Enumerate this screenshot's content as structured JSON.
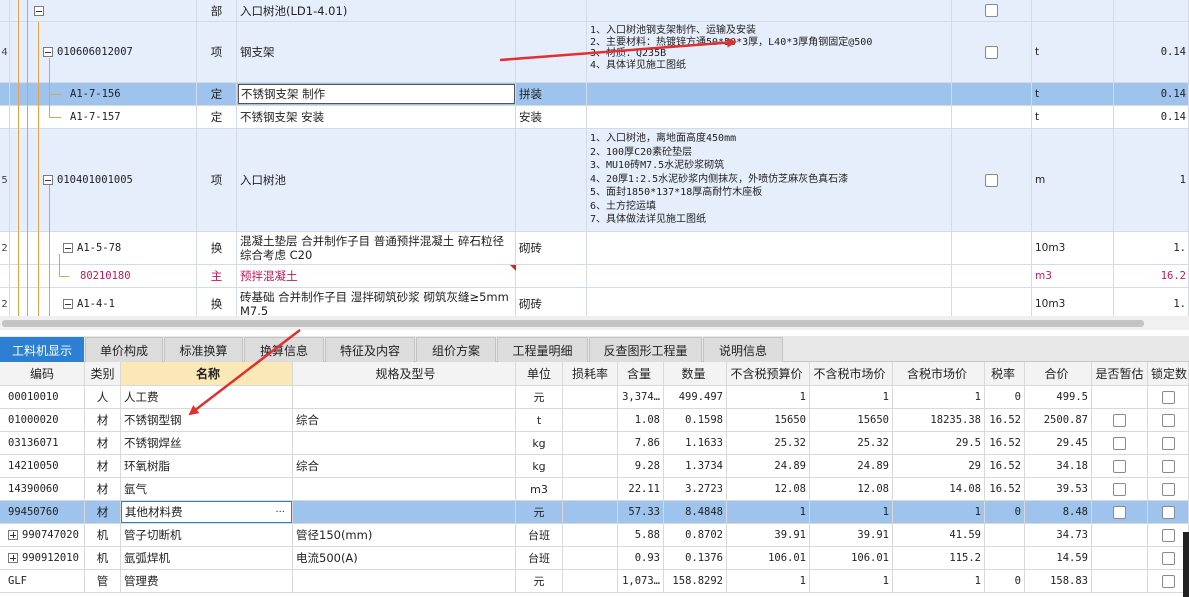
{
  "top_rows": [
    {
      "no": "",
      "code": "",
      "type": "部",
      "name": "入口树池(LD1-4.01)",
      "spec": "",
      "features": [],
      "unit": "",
      "qty": "",
      "has_checkbox": true
    },
    {
      "no": "4",
      "code": "010606012007",
      "type": "项",
      "name": "钢支架",
      "spec": "",
      "features": [
        "1、入口树池钢支架制作、运输及安装",
        "2、主要材料：热镀锌方通50*50*3厚，L40*3厚角钢固定@500",
        "3、材质：Q235B",
        "4、具体详见施工图纸"
      ],
      "unit": "t",
      "qty": "0.14",
      "has_checkbox": true
    },
    {
      "no": "",
      "code": "A1-7-156",
      "type": "定",
      "name": "不锈钢支架 制作",
      "spec": "拼装",
      "features": [],
      "unit": "t",
      "qty": "0.14",
      "has_checkbox": false
    },
    {
      "no": "",
      "code": "A1-7-157",
      "type": "定",
      "name": "不锈钢支架 安装",
      "spec": "安装",
      "features": [],
      "unit": "t",
      "qty": "0.14",
      "has_checkbox": false
    },
    {
      "no": "5",
      "code": "010401001005",
      "type": "项",
      "name": "入口树池",
      "spec": "",
      "features": [
        "1、入口树池，离地面高度450mm",
        "2、100厚C20素砼垫层",
        "3、MU10砖M7.5水泥砂浆砌筑",
        "4、20厚1:2.5水泥砂浆内侧抹灰，外喷仿芝麻灰色真石漆",
        "5、面封1850*137*18厚高耐竹木座板",
        "6、土方挖运填",
        "7、具体做法详见施工图纸"
      ],
      "unit": "m",
      "qty": "1",
      "has_checkbox": true
    },
    {
      "no": "2",
      "code": "A1-5-78",
      "type": "换",
      "name": "混凝土垫层  合并制作子目 普通预拌混凝土 碎石粒径综合考虑 C20",
      "spec": "砌砖",
      "features": [],
      "unit": "10m3",
      "qty": "1.",
      "has_checkbox": false
    },
    {
      "no": "",
      "code": "80210180",
      "type": "主",
      "name": "预拌混凝土",
      "spec": "",
      "features": [],
      "unit": "m3",
      "qty": "16.2",
      "has_checkbox": false
    },
    {
      "no": "2",
      "code": "A1-4-1",
      "type": "换",
      "name": "砖基础  合并制作子目 湿拌砌筑砂浆 砌筑灰缝≥5mm M7.5",
      "spec": "砌砖",
      "features": [],
      "unit": "10m3",
      "qty": "1.",
      "has_checkbox": false
    }
  ],
  "tabs": [
    "工料机显示",
    "单价构成",
    "标准换算",
    "换算信息",
    "特征及内容",
    "组价方案",
    "工程量明细",
    "反查图形工程量",
    "说明信息"
  ],
  "active_tab": 0,
  "columns": [
    "编码",
    "类别",
    "名称",
    "规格及型号",
    "单位",
    "损耗率",
    "含量",
    "数量",
    "不含税预算价",
    "不含税市场价",
    "含税市场价",
    "税率",
    "合价",
    "是否暂估",
    "锁定数"
  ],
  "rows": [
    {
      "code": "00010010",
      "cat": "人",
      "name": "人工费",
      "spec": "",
      "unit": "元",
      "loss": "",
      "amount": "3,374…",
      "qty": "499.497",
      "p1": "1",
      "p2": "1",
      "p3": "1",
      "tax": "0",
      "total": "499.5",
      "est": false,
      "lock": true,
      "expander": ""
    },
    {
      "code": "01000020",
      "cat": "材",
      "name": "不锈钢型钢",
      "spec": "综合",
      "unit": "t",
      "loss": "",
      "amount": "1.08",
      "qty": "0.1598",
      "p1": "15650",
      "p2": "15650",
      "p3": "18235.38",
      "tax": "16.52",
      "total": "2500.87",
      "est": true,
      "lock": true,
      "expander": ""
    },
    {
      "code": "03136071",
      "cat": "材",
      "name": "不锈钢焊丝",
      "spec": "",
      "unit": "kg",
      "loss": "",
      "amount": "7.86",
      "qty": "1.1633",
      "p1": "25.32",
      "p2": "25.32",
      "p3": "29.5",
      "tax": "16.52",
      "total": "29.45",
      "est": true,
      "lock": true,
      "expander": ""
    },
    {
      "code": "14210050",
      "cat": "材",
      "name": "环氧树脂",
      "spec": "综合",
      "unit": "kg",
      "loss": "",
      "amount": "9.28",
      "qty": "1.3734",
      "p1": "24.89",
      "p2": "24.89",
      "p3": "29",
      "tax": "16.52",
      "total": "34.18",
      "est": true,
      "lock": true,
      "expander": ""
    },
    {
      "code": "14390060",
      "cat": "材",
      "name": "氩气",
      "spec": "",
      "unit": "m3",
      "loss": "",
      "amount": "22.11",
      "qty": "3.2723",
      "p1": "12.08",
      "p2": "12.08",
      "p3": "14.08",
      "tax": "16.52",
      "total": "39.53",
      "est": true,
      "lock": true,
      "expander": ""
    },
    {
      "code": "99450760",
      "cat": "材",
      "name": "其他材料费",
      "spec": "",
      "unit": "元",
      "loss": "",
      "amount": "57.33",
      "qty": "8.4848",
      "p1": "1",
      "p2": "1",
      "p3": "1",
      "tax": "0",
      "total": "8.48",
      "est": true,
      "lock": true,
      "expander": "",
      "selected": true
    },
    {
      "code": "990747020",
      "cat": "机",
      "name": "管子切断机",
      "spec": "管径150(mm)",
      "unit": "台班",
      "loss": "",
      "amount": "5.88",
      "qty": "0.8702",
      "p1": "39.91",
      "p2": "39.91",
      "p3": "41.59",
      "tax": "",
      "total": "34.73",
      "est": false,
      "lock": true,
      "expander": "+"
    },
    {
      "code": "990912010",
      "cat": "机",
      "name": "氩弧焊机",
      "spec": "电流500(A)",
      "unit": "台班",
      "loss": "",
      "amount": "0.93",
      "qty": "0.1376",
      "p1": "106.01",
      "p2": "106.01",
      "p3": "115.2",
      "tax": "",
      "total": "14.59",
      "est": false,
      "lock": true,
      "expander": "+"
    },
    {
      "code": "GLF",
      "cat": "管",
      "name": "管理费",
      "spec": "",
      "unit": "元",
      "loss": "",
      "amount": "1,073…",
      "qty": "158.8292",
      "p1": "1",
      "p2": "1",
      "p3": "1",
      "tax": "0",
      "total": "158.83",
      "est": false,
      "lock": true,
      "expander": ""
    }
  ],
  "name_edit_ellipsis": "···",
  "colors": {
    "accent": "#2d7fd2",
    "selected_row": "#9ec3ec",
    "item_row": "#e6eefb",
    "tree_line": "#e5a14a",
    "arrow": "#e03030"
  }
}
